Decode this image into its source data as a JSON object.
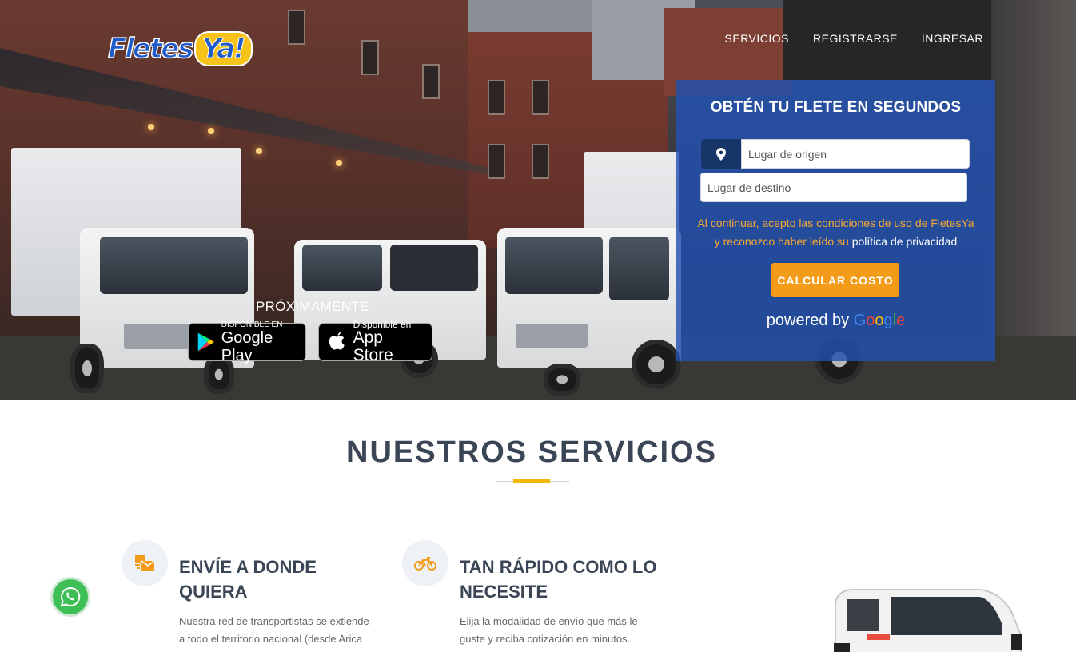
{
  "brand": {
    "logo_left": "Fletes",
    "logo_right": "Ya!",
    "colors": {
      "primary_blue": "#1f5cc9",
      "yellow": "#f7c21a",
      "orange": "#f39c1a",
      "dark_text": "#3a4556"
    }
  },
  "nav": {
    "items": [
      "SERVICIOS",
      "REGISTRARSE",
      "INGRESAR"
    ]
  },
  "apps": {
    "coming_soon": "PRÓXIMAMENTE",
    "google_play": {
      "small": "DISPONIBLE EN",
      "big": "Google Play",
      "icon": "google-play-icon"
    },
    "app_store": {
      "small": "Disponible en",
      "big": "App Store",
      "icon": "apple-icon"
    }
  },
  "quote": {
    "title": "OBTÉN TU FLETE EN SEGUNDOS",
    "origin_placeholder": "Lugar de origen",
    "destination_placeholder": "Lugar de destino",
    "terms_line1": "Al continuar, acepto las condiciones de uso de FletesYa",
    "terms_line2_prefix": "y reconozco haber leído su ",
    "terms_link": "política de privacidad",
    "button": "CALCULAR COSTO",
    "powered_by": "powered by",
    "google": [
      "G",
      "o",
      "o",
      "g",
      "l",
      "e"
    ]
  },
  "services": {
    "title": "NUESTROS SERVICIOS",
    "items": [
      {
        "icon": "package-envelope-icon",
        "title_l1": "ENVÍE A DONDE",
        "title_l2": "QUIERA",
        "text_l1": "Nuestra red de transportistas se extiende",
        "text_l2": "a todo el territorio nacional (desde Arica"
      },
      {
        "icon": "motorcycle-icon",
        "title_l1": "TAN RÁPIDO COMO LO",
        "title_l2": "NECESITE",
        "text_l1": "Elija la modalidad de envío que más le",
        "text_l2": "guste y reciba cotización en minutos."
      }
    ]
  },
  "whatsapp": {
    "icon": "whatsapp-icon"
  }
}
